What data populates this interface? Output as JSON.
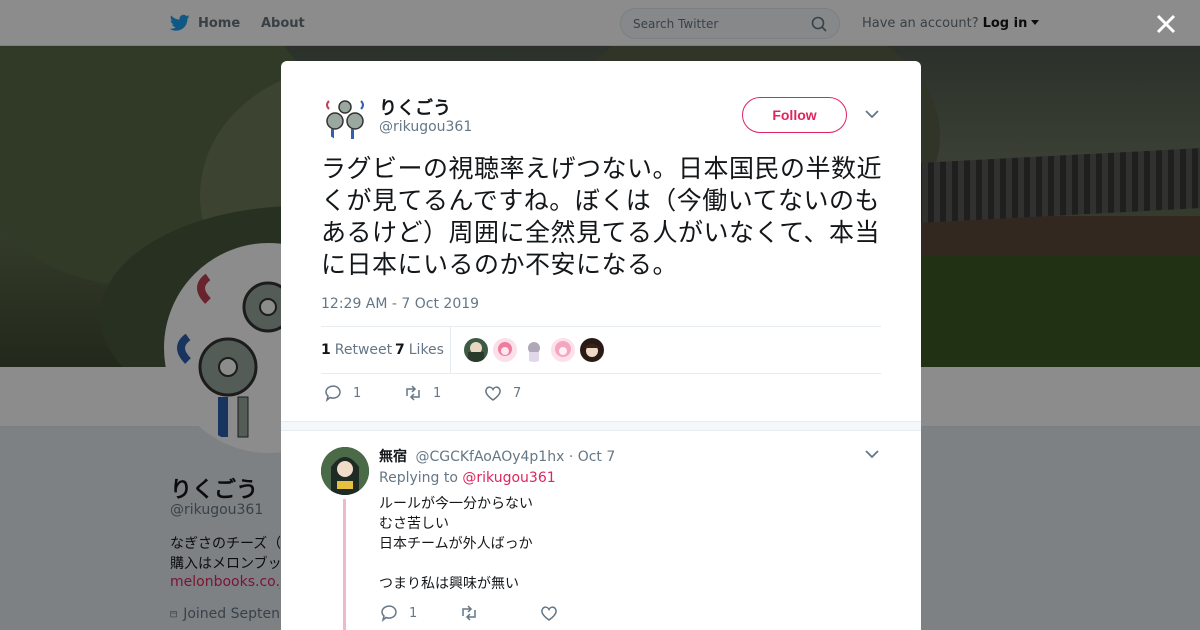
{
  "topbar": {
    "home_label": "Home",
    "about_label": "About",
    "search_placeholder": "Search Twitter",
    "have_account": "Have an account?",
    "login_label": "Log in"
  },
  "profile": {
    "name": "りくごう",
    "handle": "@rikugou361",
    "bio_lines": [
      "なぎさのチーズ（",
      "購入はメロンブッ"
    ],
    "link": "melonbooks.co.jp",
    "joined": "Joined Septen"
  },
  "tweet": {
    "author_name": "りくごう",
    "author_handle": "@rikugou361",
    "follow_label": "Follow",
    "text": "ラグビーの視聴率えげつない。日本国民の半数近くが見てるんですね。ぼくは（今働いてないのもあるけど）周囲に全然見てる人がいなくて、本当に日本にいるのか不安になる。",
    "timestamp": "12:29 AM - 7 Oct 2019",
    "retweet_count": "1",
    "retweet_label": "Retweet",
    "likes_count": "7",
    "likes_label": "Likes",
    "action_reply_count": "1",
    "action_retweet_count": "1",
    "action_like_count": "7"
  },
  "reply": {
    "name": "無宿",
    "handle": "@CGCKfAoAOy4p1hx",
    "date": "· Oct 7",
    "replying_prefix": "Replying to",
    "replying_to": "@rikugou361",
    "lines": [
      "ルールが今一分からない",
      "むさ苦しい",
      "日本チームが外人ばっか",
      "",
      "つまり私は興味が無い"
    ],
    "reply_count": "1",
    "retweet_count": "",
    "like_count": ""
  },
  "colors": {
    "accent": "#e0245e",
    "text": "#14171a",
    "muted": "#657786",
    "twitter_blue": "#1da1f2"
  }
}
